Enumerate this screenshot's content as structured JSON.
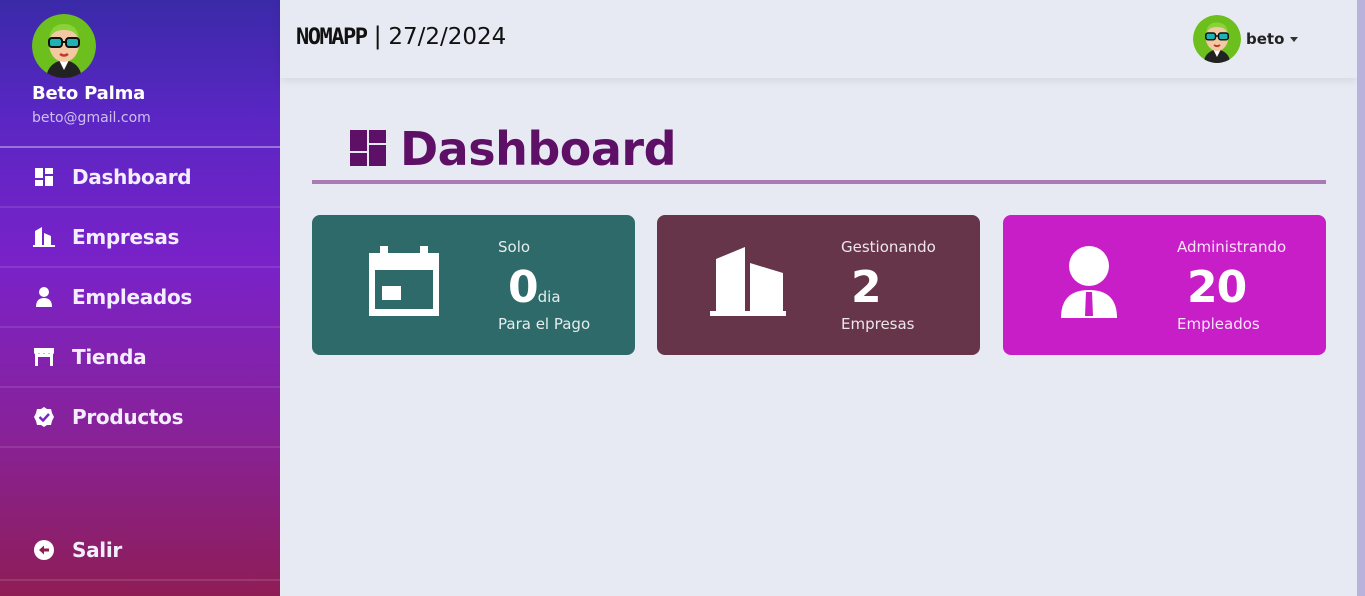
{
  "colors": {
    "sidebar_top": "#3a2aa8",
    "sidebar_bottom": "#8e1d56",
    "title": "#5e0f66",
    "card_teal": "#2e6a6a",
    "card_maroon": "#67354a",
    "card_magenta": "#c81ec8",
    "background": "#e8eaf3"
  },
  "sidebar": {
    "user_name": "Beto Palma",
    "user_email": "beto@gmail.com",
    "items": [
      {
        "label": "Dashboard",
        "icon": "dashboard-icon"
      },
      {
        "label": "Empresas",
        "icon": "buildings-icon"
      },
      {
        "label": "Empleados",
        "icon": "person-icon"
      },
      {
        "label": "Tienda",
        "icon": "store-icon"
      },
      {
        "label": "Productos",
        "icon": "verified-badge-icon"
      }
    ],
    "logout_label": "Salir",
    "logout_icon": "logout-icon"
  },
  "topbar": {
    "brand": "NOMAPP",
    "separator": "|",
    "date": "27/2/2024",
    "user": "beto"
  },
  "main": {
    "title": "Dashboard",
    "title_icon": "dashboard-icon",
    "cards": [
      {
        "icon": "calendar-icon",
        "top": "Solo",
        "value": "0",
        "unit": "dia",
        "bottom": "Para el Pago"
      },
      {
        "icon": "buildings-icon",
        "top": "Gestionando",
        "value": "2",
        "unit": "",
        "bottom": "Empresas"
      },
      {
        "icon": "person-tie-icon",
        "top": "Administrando",
        "value": "20",
        "unit": "",
        "bottom": "Empleados"
      }
    ]
  }
}
